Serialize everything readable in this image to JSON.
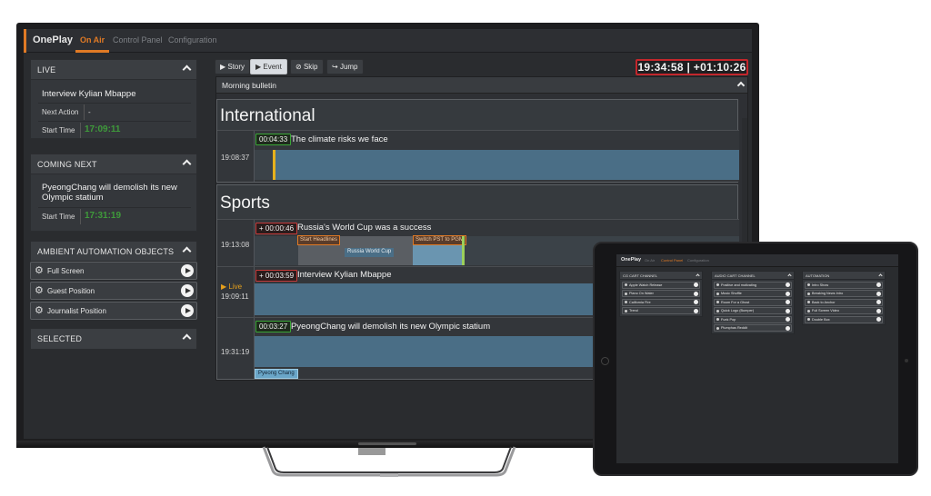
{
  "app": {
    "brand": "OnePlay",
    "tabs": [
      "On Air",
      "Control Panel",
      "Configuration"
    ],
    "active_tab": "On Air"
  },
  "live_panel": {
    "header": "LIVE",
    "title": "Interview Kylian Mbappe",
    "next_action_label": "Next Action",
    "next_action_value": "-",
    "start_time_label": "Start Time",
    "start_time_value": "17:09:11"
  },
  "coming_next_panel": {
    "header": "COMING NEXT",
    "title": "PyeongChang will demolish its new Olympic statium",
    "start_time_label": "Start Time",
    "start_time_value": "17:31:19"
  },
  "ambient_panel": {
    "header": "AMBIENT AUTOMATION OBJECTS",
    "items": [
      "Full Screen",
      "Guest Position",
      "Journalist Position"
    ]
  },
  "selected_panel": {
    "header": "SELECTED"
  },
  "toolbar": {
    "story": "Story",
    "event": "Event",
    "skip": "Skip",
    "jump": "Jump",
    "clock": "19:34:58 | +01:10:26"
  },
  "rundown": {
    "title": "Morning bulletin",
    "sections": [
      {
        "name": "International",
        "stories": [
          {
            "time": "19:08:37",
            "duration": "00:04:33",
            "duration_style": "green",
            "title": "The climate risks we face"
          }
        ]
      },
      {
        "name": "Sports",
        "stories": [
          {
            "time": "19:13:08",
            "duration": "+ 00:00:46",
            "duration_style": "red",
            "title": "Russia's World Cup was a success",
            "events": [
              "Start Headlines",
              "Russia World Cup",
              "Switch PST to PGM"
            ]
          },
          {
            "time": "19:09:11",
            "live_label": "Live",
            "duration": "+ 00:03:59",
            "duration_style": "red",
            "title": "Interview Kylian Mbappe"
          },
          {
            "time": "19:31:19",
            "duration": "00:03:27",
            "duration_style": "green",
            "title": "PyeongChang will demolish its new Olympic statium",
            "events": [
              "Pyeong Chang"
            ]
          }
        ]
      }
    ]
  },
  "tablet": {
    "brand": "OnePlay",
    "tabs": [
      "On Air",
      "Control Panel",
      "Configuration"
    ],
    "active_tab": "Control Panel",
    "columns": [
      {
        "header": "CG CART CHANNEL",
        "items": [
          "Apple Watch Release",
          "Piano On Water",
          "California Fire",
          "Trend"
        ]
      },
      {
        "header": "AUDIO CART CHANNEL",
        "items": [
          "Positive and motivating",
          "Music Shuffle",
          "Room For a Ghost",
          "Quick Logo (Bumper)",
          "Funk Pop",
          "Plumphas Reddit"
        ]
      },
      {
        "header": "AUTOMATION",
        "items": [
          "Intro Show",
          "Breaking News Intro",
          "Back to Anchor",
          "Full Screen Video",
          "Double Box"
        ]
      }
    ]
  },
  "colors": {
    "accent": "#e07a25",
    "live_green": "#3f9a3b",
    "alert_red": "#c3272c",
    "clip_blue": "#4a6e86",
    "marker_yellow": "#e6b11c"
  }
}
